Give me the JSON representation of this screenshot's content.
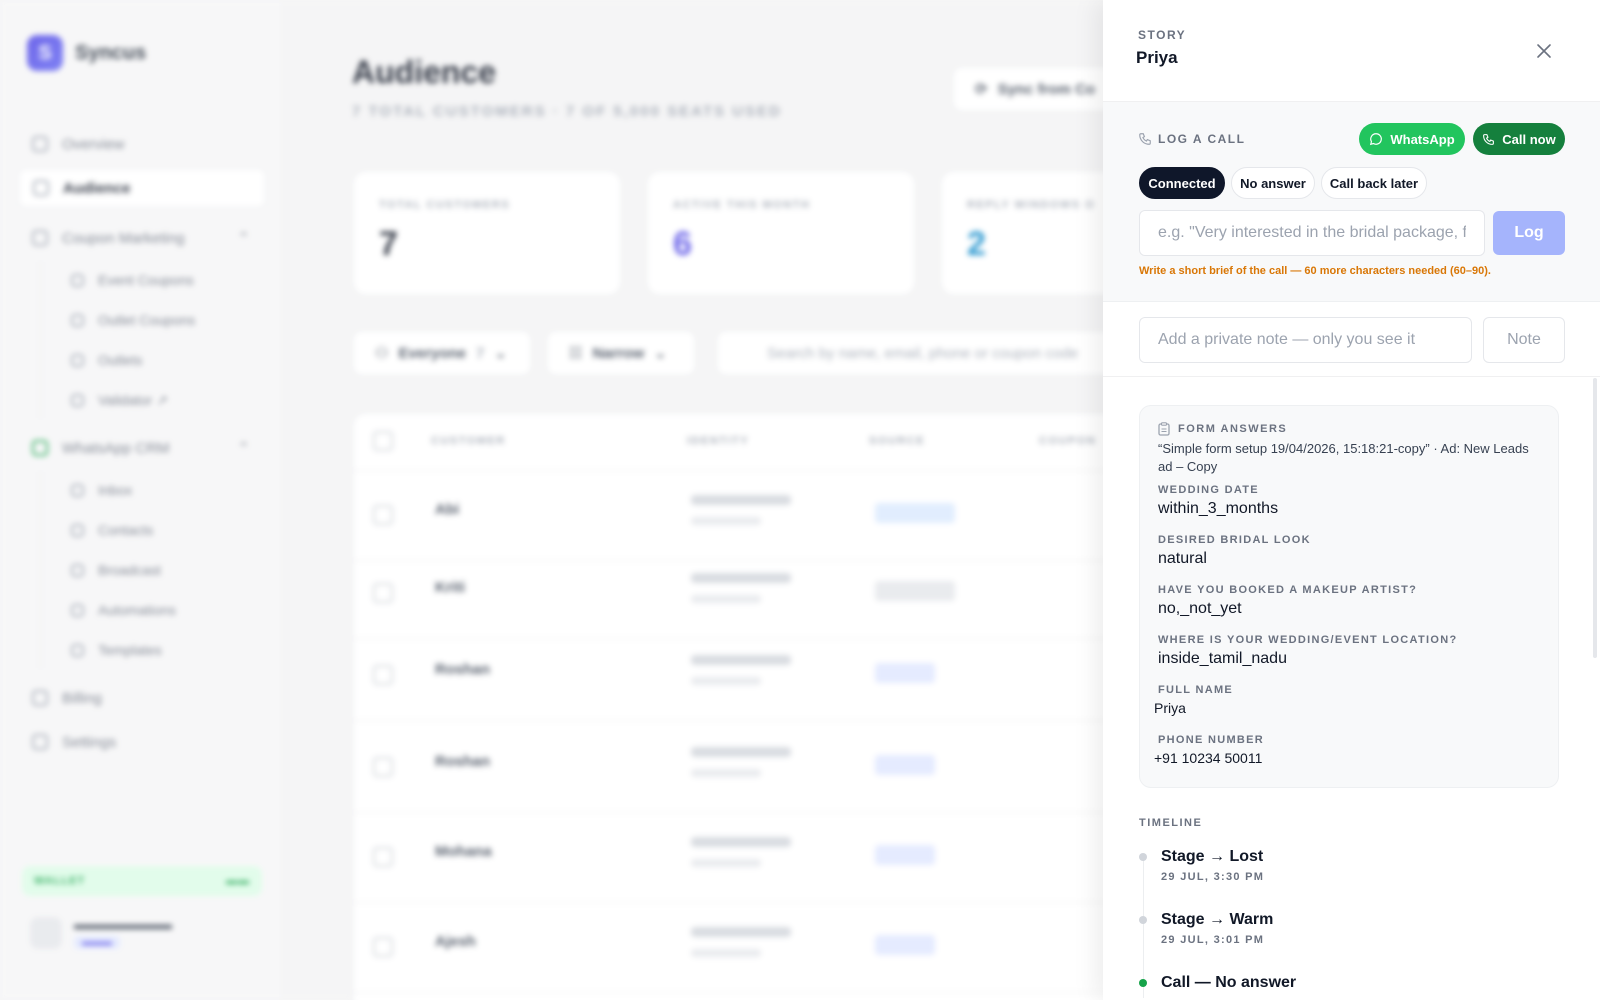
{
  "app": {
    "brand": "Syncus",
    "nav": {
      "overview": "Overview",
      "audience": "Audience",
      "coupon_marketing": "Coupon Marketing",
      "event_coupons": "Event Coupons",
      "outlet_coupons": "Outlet Coupons",
      "outlets": "Outlets",
      "validator": "Validator ↗",
      "whatsapp_crm": "WhatsApp CRM",
      "inbox": "Inbox",
      "contacts": "Contacts",
      "broadcast": "Broadcast",
      "automations": "Automations",
      "templates": "Templates",
      "billing": "Billing",
      "settings": "Settings"
    },
    "wallet_label": "WALLET"
  },
  "main": {
    "title": "Audience",
    "subtitle": "7 TOTAL CUSTOMERS · 7 OF 5,000 SEATS USED",
    "sync_label": "Sync from Co",
    "stats": [
      {
        "label": "TOTAL CUSTOMERS",
        "value": "7",
        "color": "#111827"
      },
      {
        "label": "ACTIVE THIS MONTH",
        "value": "6",
        "color": "#4f46e5"
      },
      {
        "label": "REPLY WINDOWS O",
        "value": "2",
        "color": "#0284c7"
      }
    ],
    "filters": {
      "everyone": "Everyone",
      "everyone_count": "7",
      "narrow": "Narrow",
      "search_placeholder": "Search by name, email, phone or coupon code"
    },
    "table": {
      "headers": [
        "CUSTOMER",
        "IDENTITY",
        "SOURCE",
        "COUPON"
      ],
      "rows": [
        "Abi",
        "Kriti",
        "Roshan",
        "Roshan",
        "Mohana",
        "Ajesh"
      ]
    }
  },
  "panel": {
    "label": "STORY",
    "name": "Priya",
    "log_title": "LOG A CALL",
    "whatsapp_label": "WhatsApp",
    "call_now_label": "Call now",
    "chips": [
      "Connected",
      "No answer",
      "Call back later"
    ],
    "log_placeholder": "e.g. \"Very interested in the bridal package, follow up tomorrow\"",
    "log_button": "Log",
    "hint": "Write a short brief of the call — 60 more characters needed (60–90).",
    "note_placeholder": "Add a private note — only you see it",
    "note_button": "Note",
    "form": {
      "title": "FORM ANSWERS",
      "source": "“Simple form setup 19/04/2026, 15:18:21-copy” · Ad: New Leads ad – Copy",
      "fields": [
        {
          "label": "WEDDING DATE",
          "value": "within_3_months"
        },
        {
          "label": "DESIRED BRIDAL LOOK",
          "value": "natural"
        },
        {
          "label": "HAVE YOU BOOKED A MAKEUP ARTIST?",
          "value": "no,_not_yet"
        },
        {
          "label": "WHERE IS YOUR WEDDING/EVENT LOCATION?",
          "value": "inside_tamil_nadu"
        },
        {
          "label": "FULL NAME",
          "value": "Priya"
        },
        {
          "label": "PHONE NUMBER",
          "value": "+91 10234 50011"
        }
      ]
    },
    "timeline": {
      "title": "TIMELINE",
      "items": [
        {
          "text": "Stage → Lost",
          "time": "29 JUL, 3:30 PM"
        },
        {
          "text": "Stage → Warm",
          "time": "29 JUL, 3:01 PM"
        },
        {
          "text": "Call — No answer",
          "time": ""
        }
      ]
    }
  }
}
